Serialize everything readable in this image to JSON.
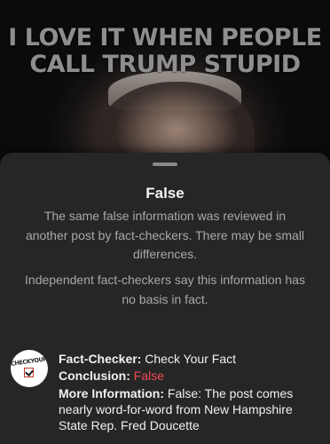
{
  "post": {
    "meme_line_1": "I LOVE IT WHEN PEOPLE",
    "meme_line_2": "CALL TRUMP STUPID"
  },
  "sheet": {
    "title": "False",
    "description_1": "The same false information was reviewed in another post by fact-checkers. There may be small differences.",
    "description_2": "Independent fact-checkers say this information has no basis in fact."
  },
  "fact_check": {
    "logo_text": "CHECKYOURFACT",
    "checker_label": "Fact-Checker:",
    "checker_value": "Check Your Fact",
    "conclusion_label": "Conclusion:",
    "conclusion_value": "False",
    "more_label": "More Information:",
    "more_value": "False: The post comes nearly word-for-word from New Hampshire State Rep. Fred Doucette",
    "conclusion_color": "#ed4956"
  }
}
